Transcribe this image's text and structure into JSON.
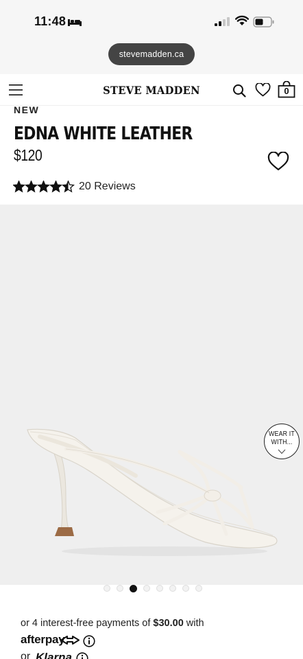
{
  "status_bar": {
    "time": "11:48",
    "icons": [
      "bed-icon",
      "signal-icon",
      "wifi-icon",
      "battery-icon"
    ]
  },
  "browser": {
    "url": "stevemadden.ca"
  },
  "header": {
    "brand": "STEVE MADDEN",
    "bag_count": "0",
    "icons": [
      "menu-icon",
      "search-icon",
      "heart-icon",
      "bag-icon"
    ]
  },
  "product": {
    "badge": "NEW",
    "title": "EDNA WHITE LEATHER",
    "price": "$120",
    "rating": 4.5,
    "rating_max": 5,
    "reviews": "20 Reviews"
  },
  "gallery": {
    "wear_it_label_1": "WEAR IT",
    "wear_it_label_2": "WITH...",
    "dot_count": 8,
    "active_dot": 3
  },
  "payments": {
    "afterpay_prefix": "or 4 interest-free payments of ",
    "afterpay_amount": "$30.00",
    "afterpay_suffix": " with",
    "afterpay_brand": "afterpay",
    "klarna_prefix": "or",
    "klarna_brand": "Klarna"
  },
  "colors": {
    "accent": "#111111",
    "gallery_background": "#efefef",
    "url_pill": "#444444"
  }
}
